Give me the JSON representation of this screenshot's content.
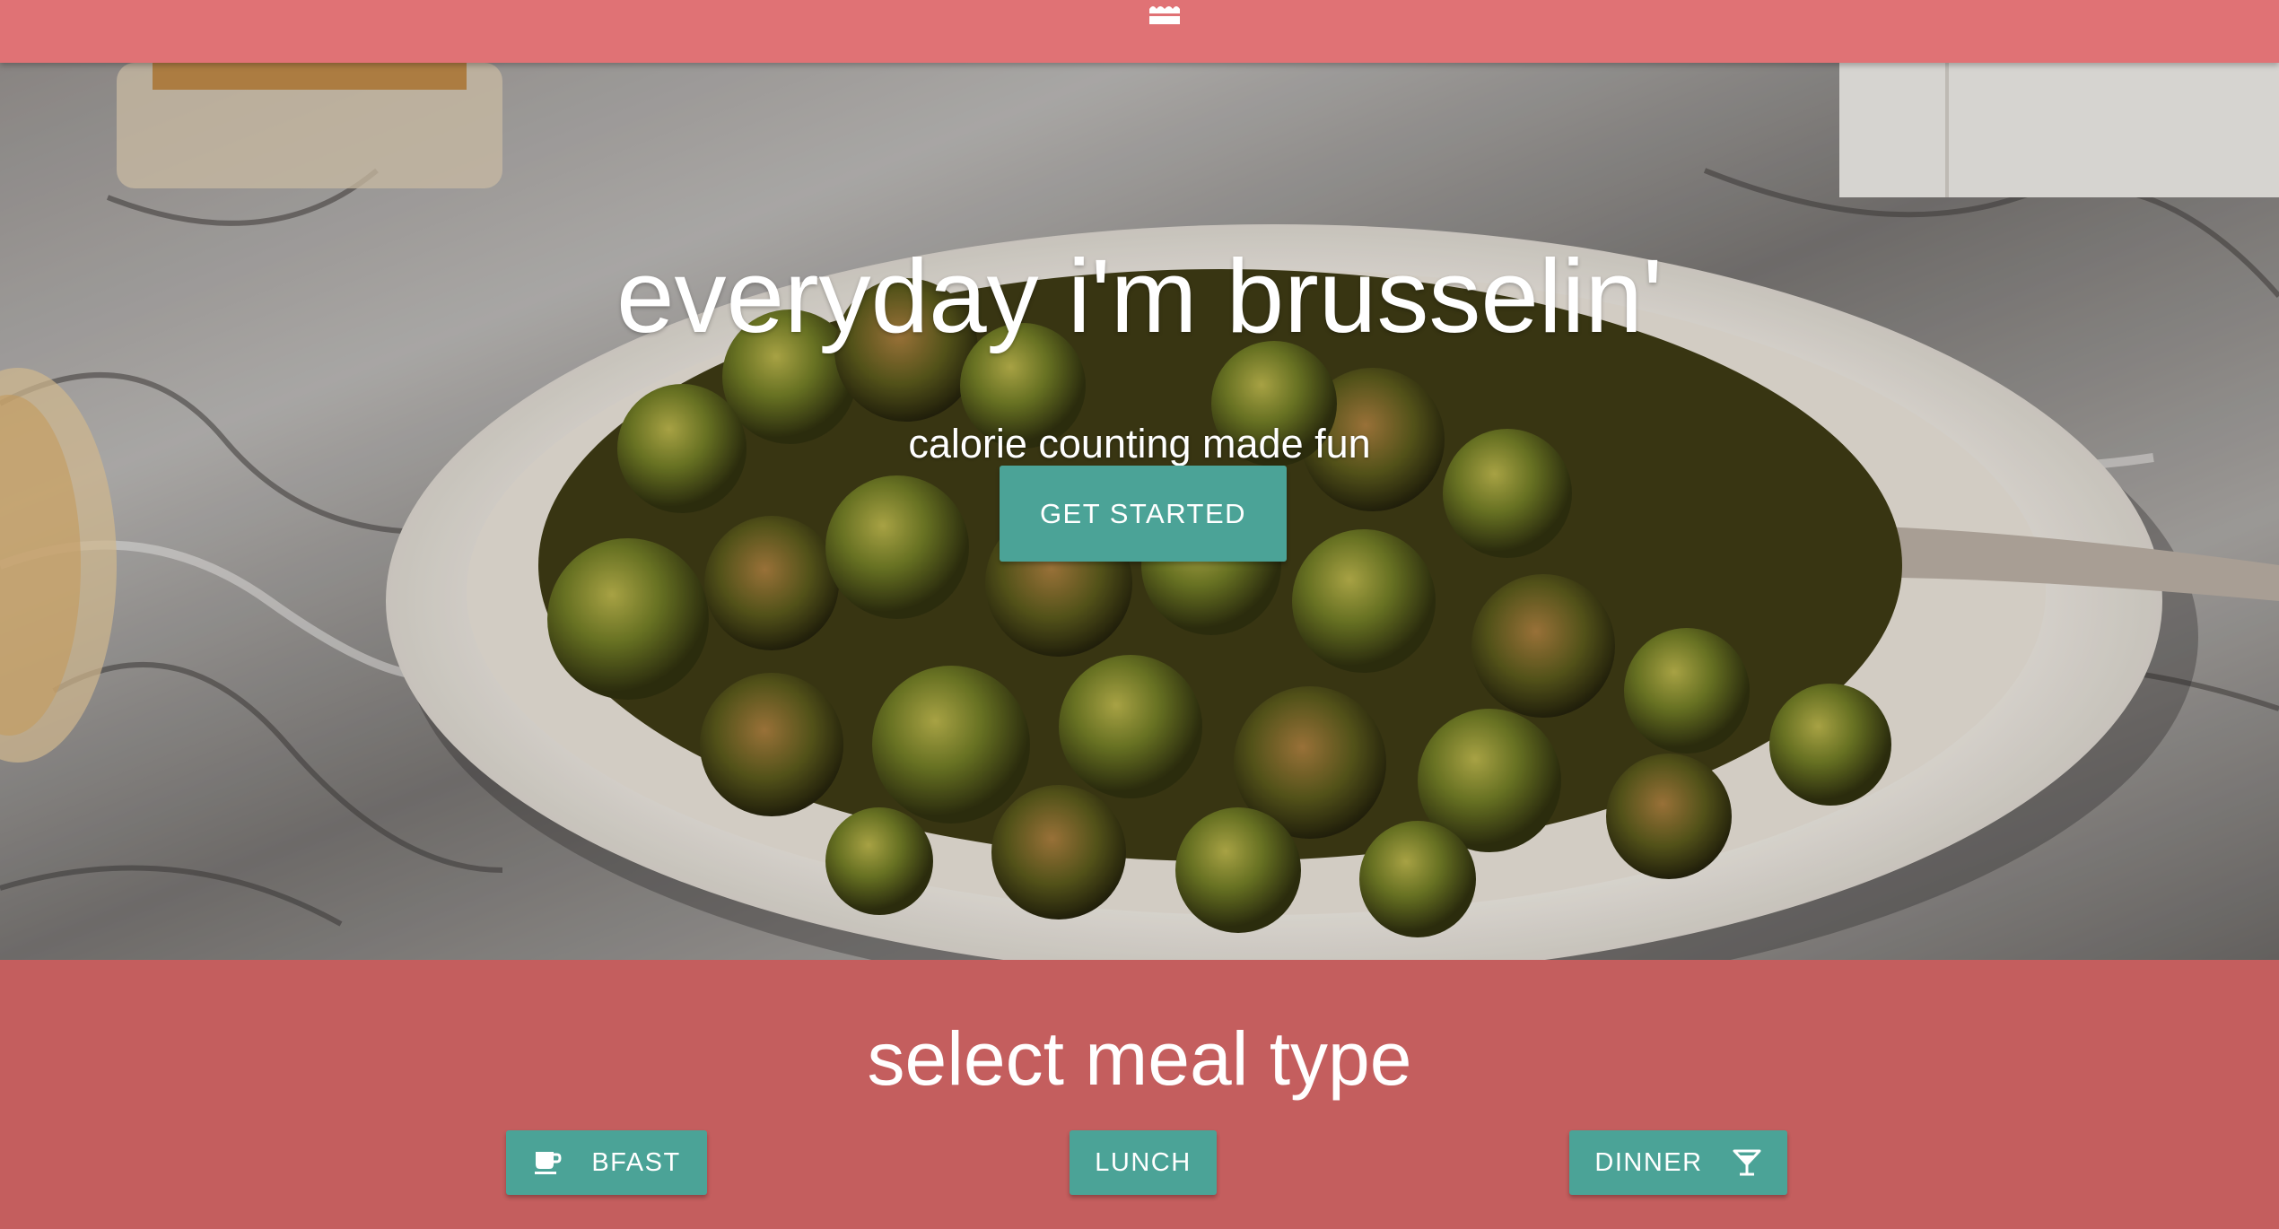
{
  "nav": {
    "logo_icon": "cake-icon",
    "bar_color": "#e07275"
  },
  "hero": {
    "title": "everyday i'm brusselin'",
    "subtitle": "calorie counting made fun",
    "cta_label": "GET STARTED",
    "background": "roasted-brussels-sprouts-photo"
  },
  "meal": {
    "heading": "select meal type",
    "buttons": [
      {
        "label": "BFAST",
        "icon": "coffee-cup-icon"
      },
      {
        "label": "LUNCH"
      },
      {
        "label": "DINNER",
        "icon": "cocktail-glass-icon"
      }
    ]
  },
  "colors": {
    "accent": "#4ba397",
    "section_background": "#c45e5e"
  }
}
